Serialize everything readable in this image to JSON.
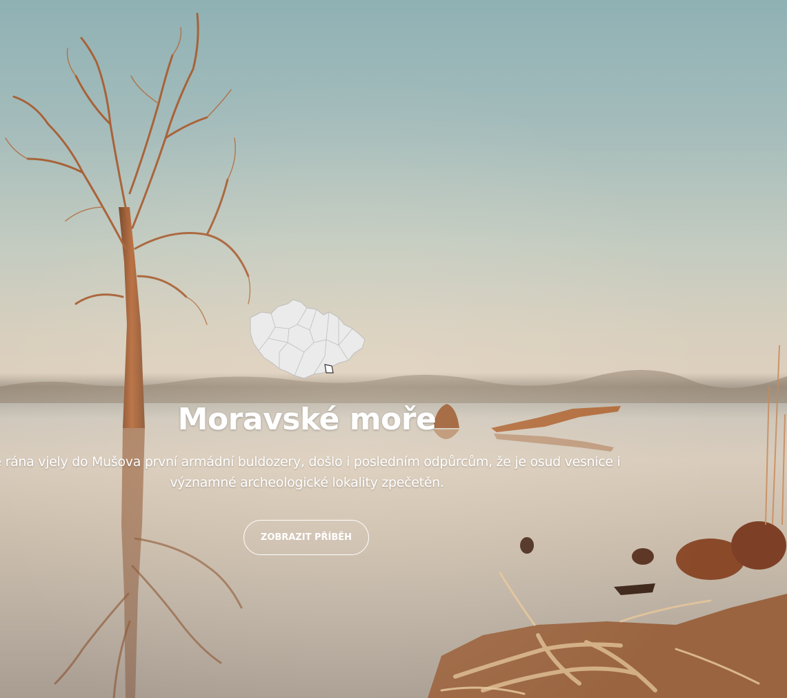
{
  "hero": {
    "title": "Moravské moře",
    "description": "e rána vjely do Mušova první armádní buldozery, došlo i posledním odpůrcům, že je osud vesnice i významné archeologické lokality zpečetěn.",
    "cta_label": "ZOBRAZIT PŘÍBĚH",
    "map_icon": "czech-republic-map-icon"
  },
  "colors": {
    "text": "#ffffff",
    "map_fill": "#e9e9e9",
    "map_stroke": "#b9b9b9"
  }
}
